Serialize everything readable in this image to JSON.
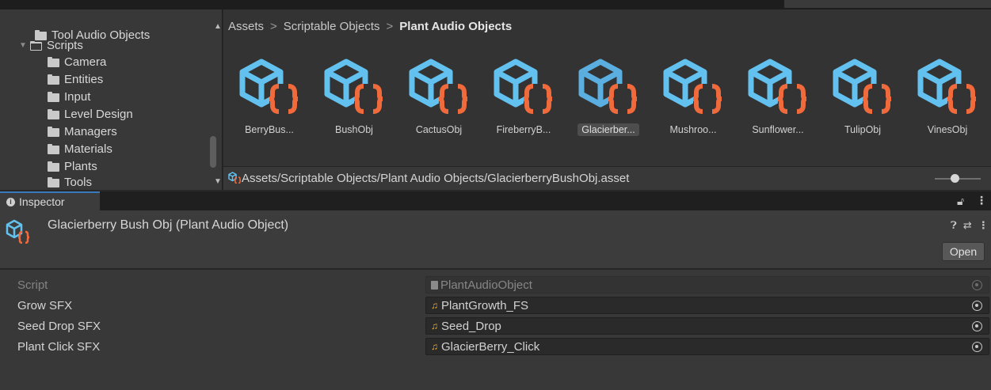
{
  "tree": {
    "items": [
      {
        "label": "Tool Audio Objects"
      },
      {
        "label": "Scripts"
      },
      {
        "label": "Camera"
      },
      {
        "label": "Entities"
      },
      {
        "label": "Input"
      },
      {
        "label": "Level Design"
      },
      {
        "label": "Managers"
      },
      {
        "label": "Materials"
      },
      {
        "label": "Plants"
      },
      {
        "label": "Tools"
      }
    ]
  },
  "browser": {
    "breadcrumb": [
      "Assets",
      "Scriptable Objects",
      "Plant Audio Objects"
    ],
    "breadcrumb_sep": ">",
    "assets": [
      {
        "label": "BerryBus...",
        "selected": false
      },
      {
        "label": "BushObj",
        "selected": false
      },
      {
        "label": "CactusObj",
        "selected": false
      },
      {
        "label": "FireberryB...",
        "selected": false
      },
      {
        "label": "Glacierber...",
        "selected": true
      },
      {
        "label": "Mushroo...",
        "selected": false
      },
      {
        "label": "Sunflower...",
        "selected": false
      },
      {
        "label": "TulipObj",
        "selected": false
      },
      {
        "label": "VinesObj",
        "selected": false
      }
    ],
    "path": "Assets/Scriptable Objects/Plant Audio Objects/GlacierberryBushObj.asset"
  },
  "inspector": {
    "tab_label": "Inspector",
    "title": "Glacierberry Bush Obj (Plant Audio Object)",
    "open_label": "Open",
    "properties": [
      {
        "label": "Script",
        "value": "PlantAudioObject",
        "disabled": true
      },
      {
        "label": "Grow SFX",
        "value": "PlantGrowth_FS",
        "disabled": false
      },
      {
        "label": "Seed Drop SFX",
        "value": "Seed_Drop",
        "disabled": false
      },
      {
        "label": "Plant Click SFX",
        "value": "GlacierBerry_Click",
        "disabled": false
      }
    ]
  },
  "colors": {
    "cube_blue": "#63c1f0",
    "cube_blue_selected": "#5aaee0",
    "braces_orange": "#f06a3c",
    "tab_accent": "#3a79bb"
  }
}
